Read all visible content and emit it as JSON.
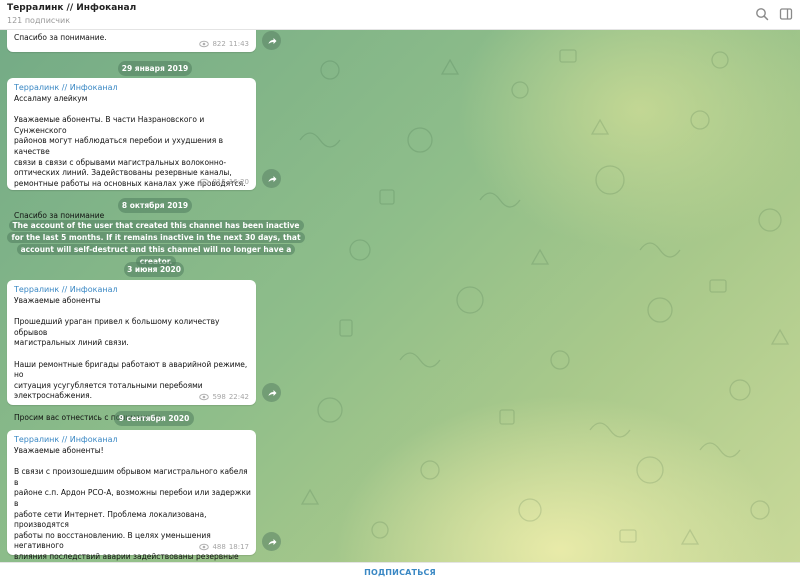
{
  "header": {
    "title": "Терралинк // Инфоканал",
    "subtitle": "121 подписчик"
  },
  "messages": [
    {
      "text": "Спасибо за понимание.",
      "views": "822",
      "time": "11:43"
    },
    {
      "author": "Терралинк // Инфоканал",
      "text": "Ассаламу алейкум\n\nУважаемые абоненты. В части Назрановского и Сунженского\nрайонов могут наблюдаться перебои и ухудшения в качестве\nсвязи в связи с обрывами магистральных волоконно-\nоптических линий. Задействованы резервные каналы,\nремонтные работы на основных каналах уже проводятся.\n\n\nСпасибо за понимание",
      "views": "915",
      "time": "16:20"
    },
    {
      "author": "Терралинк // Инфоканал",
      "text": "Уважаемые абоненты\n\nПрошедший ураган привел к большому количеству обрывов\nмагистральных линий связи.\n\nНаши ремонтные бригады работают в аварийной режиме, но\nситуация усугубляется тотальными перебоями\nэлектроснабжения.\n\nПросим вас отнестись с пониманием.",
      "views": "598",
      "time": "22:42"
    },
    {
      "author": "Терралинк // Инфоканал",
      "text": "Уважаемые абоненты!\n\nВ связи с произошедшим обрывом магистрального кабеля в\nрайоне с.п. Ардон РСО-А, возможны перебои или задержки в\nработе сети Интернет. Проблема локализована, производятся\nработы по восстановлению. В целях уменьшения негативного\nвлияния последствий аварии задействованы резервные каналы\nсвязи.\n\nСпасибо за понимание.",
      "views": "488",
      "time": "18:17"
    }
  ],
  "dates": [
    "29 января 2019",
    "8 октября 2019",
    "3 июня 2020",
    "9 сентября 2020"
  ],
  "service_message": "The account of the user that created this channel has been inactive for the last 5 months. If it remains inactive in the next 30 days, that account will self-destruct and this channel will no longer have a creator.",
  "footer": {
    "subscribe_label": "ПОДПИСАТЬСЯ"
  },
  "icons": {
    "search": "search-icon",
    "side_panel": "side-panel-icon",
    "views": "eye-icon",
    "share": "share-arrow-icon"
  },
  "colors": {
    "accent": "#3a88c4",
    "meta": "#a5a5a5"
  }
}
